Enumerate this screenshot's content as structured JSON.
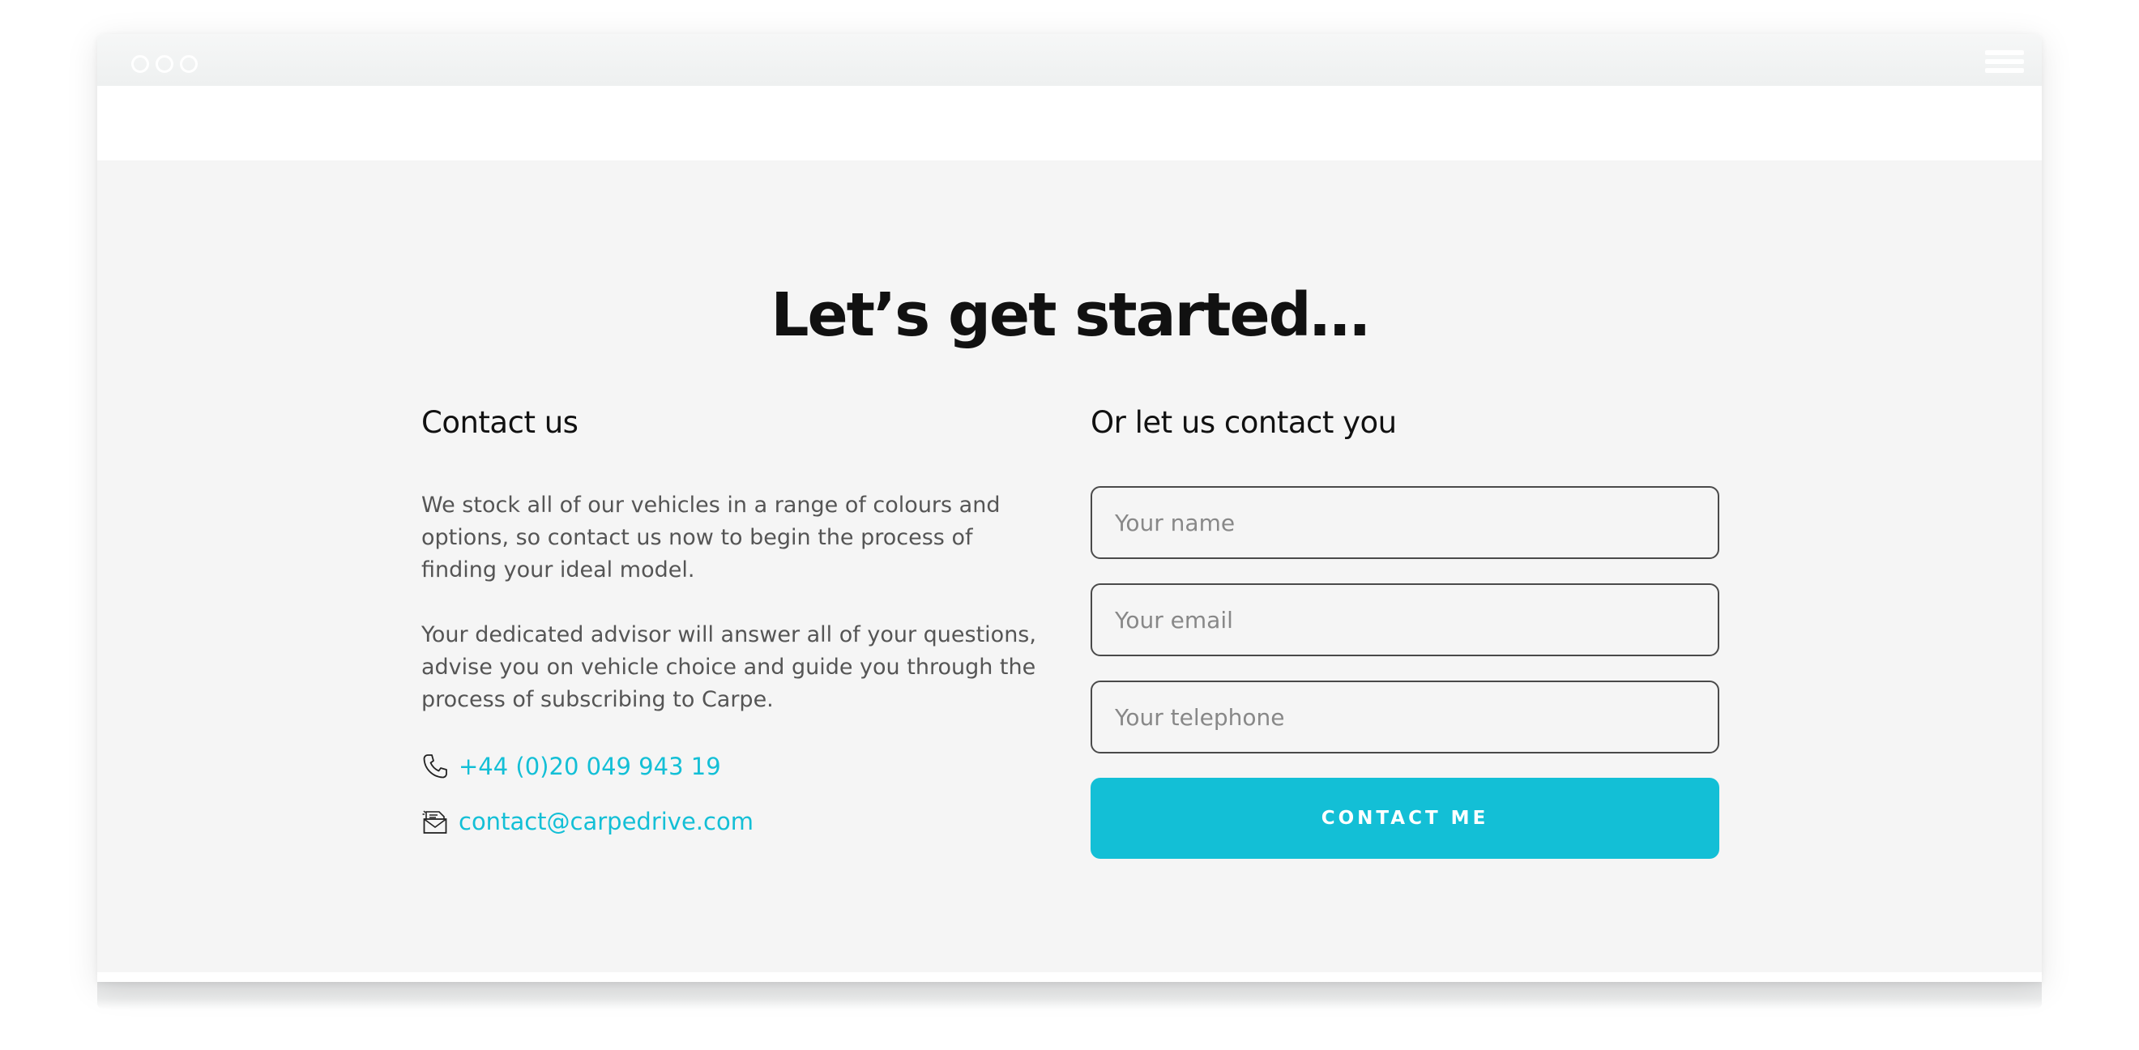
{
  "window": {
    "controls": [
      "close-dot",
      "minimize-dot",
      "maximize-dot"
    ],
    "menu_icon": "hamburger-menu-icon"
  },
  "section": {
    "headline": "Let’s get started…"
  },
  "contact_us": {
    "title": "Contact us",
    "paragraph_1": "We stock all of our vehicles in a range of colours and options, so contact us now to begin the process of finding your ideal model.",
    "paragraph_2": "Your dedicated advisor will answer all of your questions, advise you on vehicle choice and guide you through the process of subscribing to Carpe.",
    "phone": {
      "icon": "phone-icon",
      "text": "+44 (0)20 049 943 19"
    },
    "email": {
      "icon": "envelope-icon",
      "text": "contact@carpedrive.com"
    }
  },
  "contact_form": {
    "title": "Or let us contact you",
    "name_field": {
      "value": "",
      "placeholder": "Your name"
    },
    "email_field": {
      "value": "",
      "placeholder": "Your email"
    },
    "telephone_field": {
      "value": "",
      "placeholder": "Your telephone"
    },
    "submit_label": "CONTACT ME"
  },
  "colors": {
    "accent": "#13bfd6",
    "section_background": "#f5f5f5",
    "heading": "#111111",
    "body_text": "#555555"
  }
}
